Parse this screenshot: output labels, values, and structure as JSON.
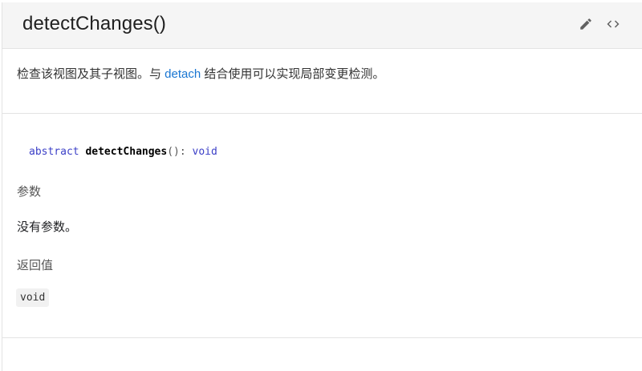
{
  "header": {
    "title": "detectChanges()"
  },
  "icons": {
    "edit": "pencil-icon",
    "code": "code-brackets-icon"
  },
  "description": {
    "before": "检查该视图及其子视图。与 ",
    "link": "detach",
    "after": " 结合使用可以实现局部变更检测。"
  },
  "signature": {
    "keyword": "abstract",
    "name": "detectChanges",
    "punc": "():",
    "returns": "void"
  },
  "params": {
    "heading": "参数",
    "text": "没有参数。"
  },
  "returns": {
    "heading": "返回值",
    "value": "void"
  },
  "colors": {
    "link": "#1976d2",
    "keyword": "#3b3fc7",
    "header_bg": "#f5f5f5"
  }
}
